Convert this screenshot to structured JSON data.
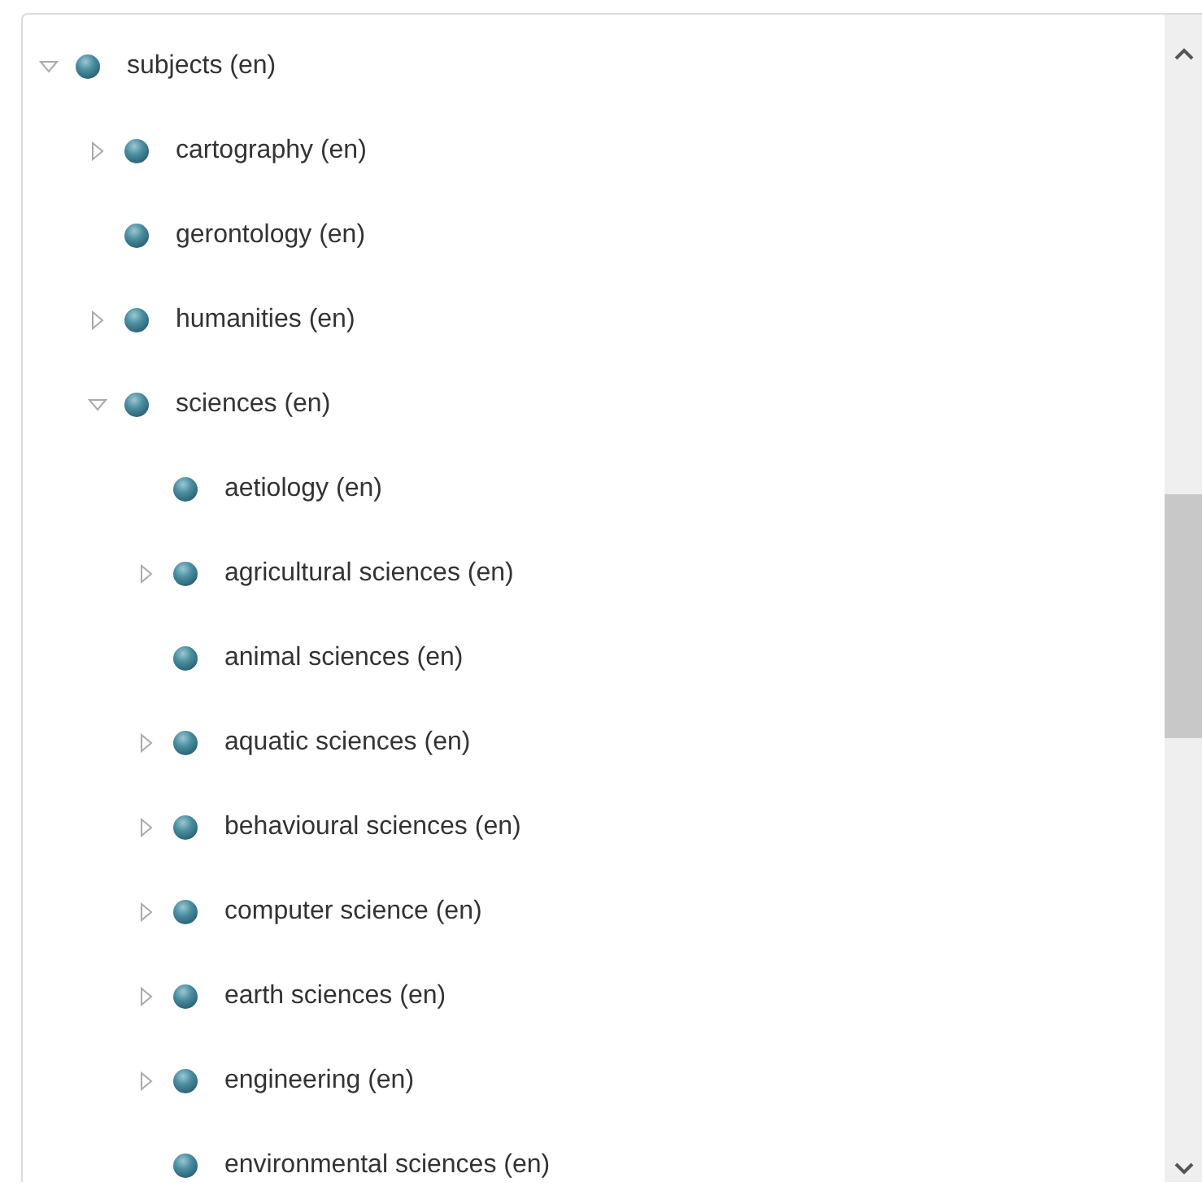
{
  "tree": [
    {
      "label": "subjects (en)",
      "kind": "branch",
      "expanded": true,
      "children": [
        {
          "label": "cartography (en)",
          "kind": "branch",
          "expanded": false
        },
        {
          "label": "gerontology (en)",
          "kind": "leaf"
        },
        {
          "label": "humanities (en)",
          "kind": "branch",
          "expanded": false
        },
        {
          "label": "sciences (en)",
          "kind": "branch",
          "expanded": true,
          "children": [
            {
              "label": "aetiology (en)",
              "kind": "leaf"
            },
            {
              "label": "agricultural sciences (en)",
              "kind": "branch",
              "expanded": false
            },
            {
              "label": "animal sciences (en)",
              "kind": "leaf"
            },
            {
              "label": "aquatic sciences (en)",
              "kind": "branch",
              "expanded": false
            },
            {
              "label": "behavioural sciences (en)",
              "kind": "branch",
              "expanded": false
            },
            {
              "label": "computer science (en)",
              "kind": "branch",
              "expanded": false
            },
            {
              "label": "earth sciences (en)",
              "kind": "branch",
              "expanded": false
            },
            {
              "label": "engineering (en)",
              "kind": "branch",
              "expanded": false
            },
            {
              "label": "environmental sciences (en)",
              "kind": "leaf"
            }
          ]
        }
      ]
    }
  ]
}
